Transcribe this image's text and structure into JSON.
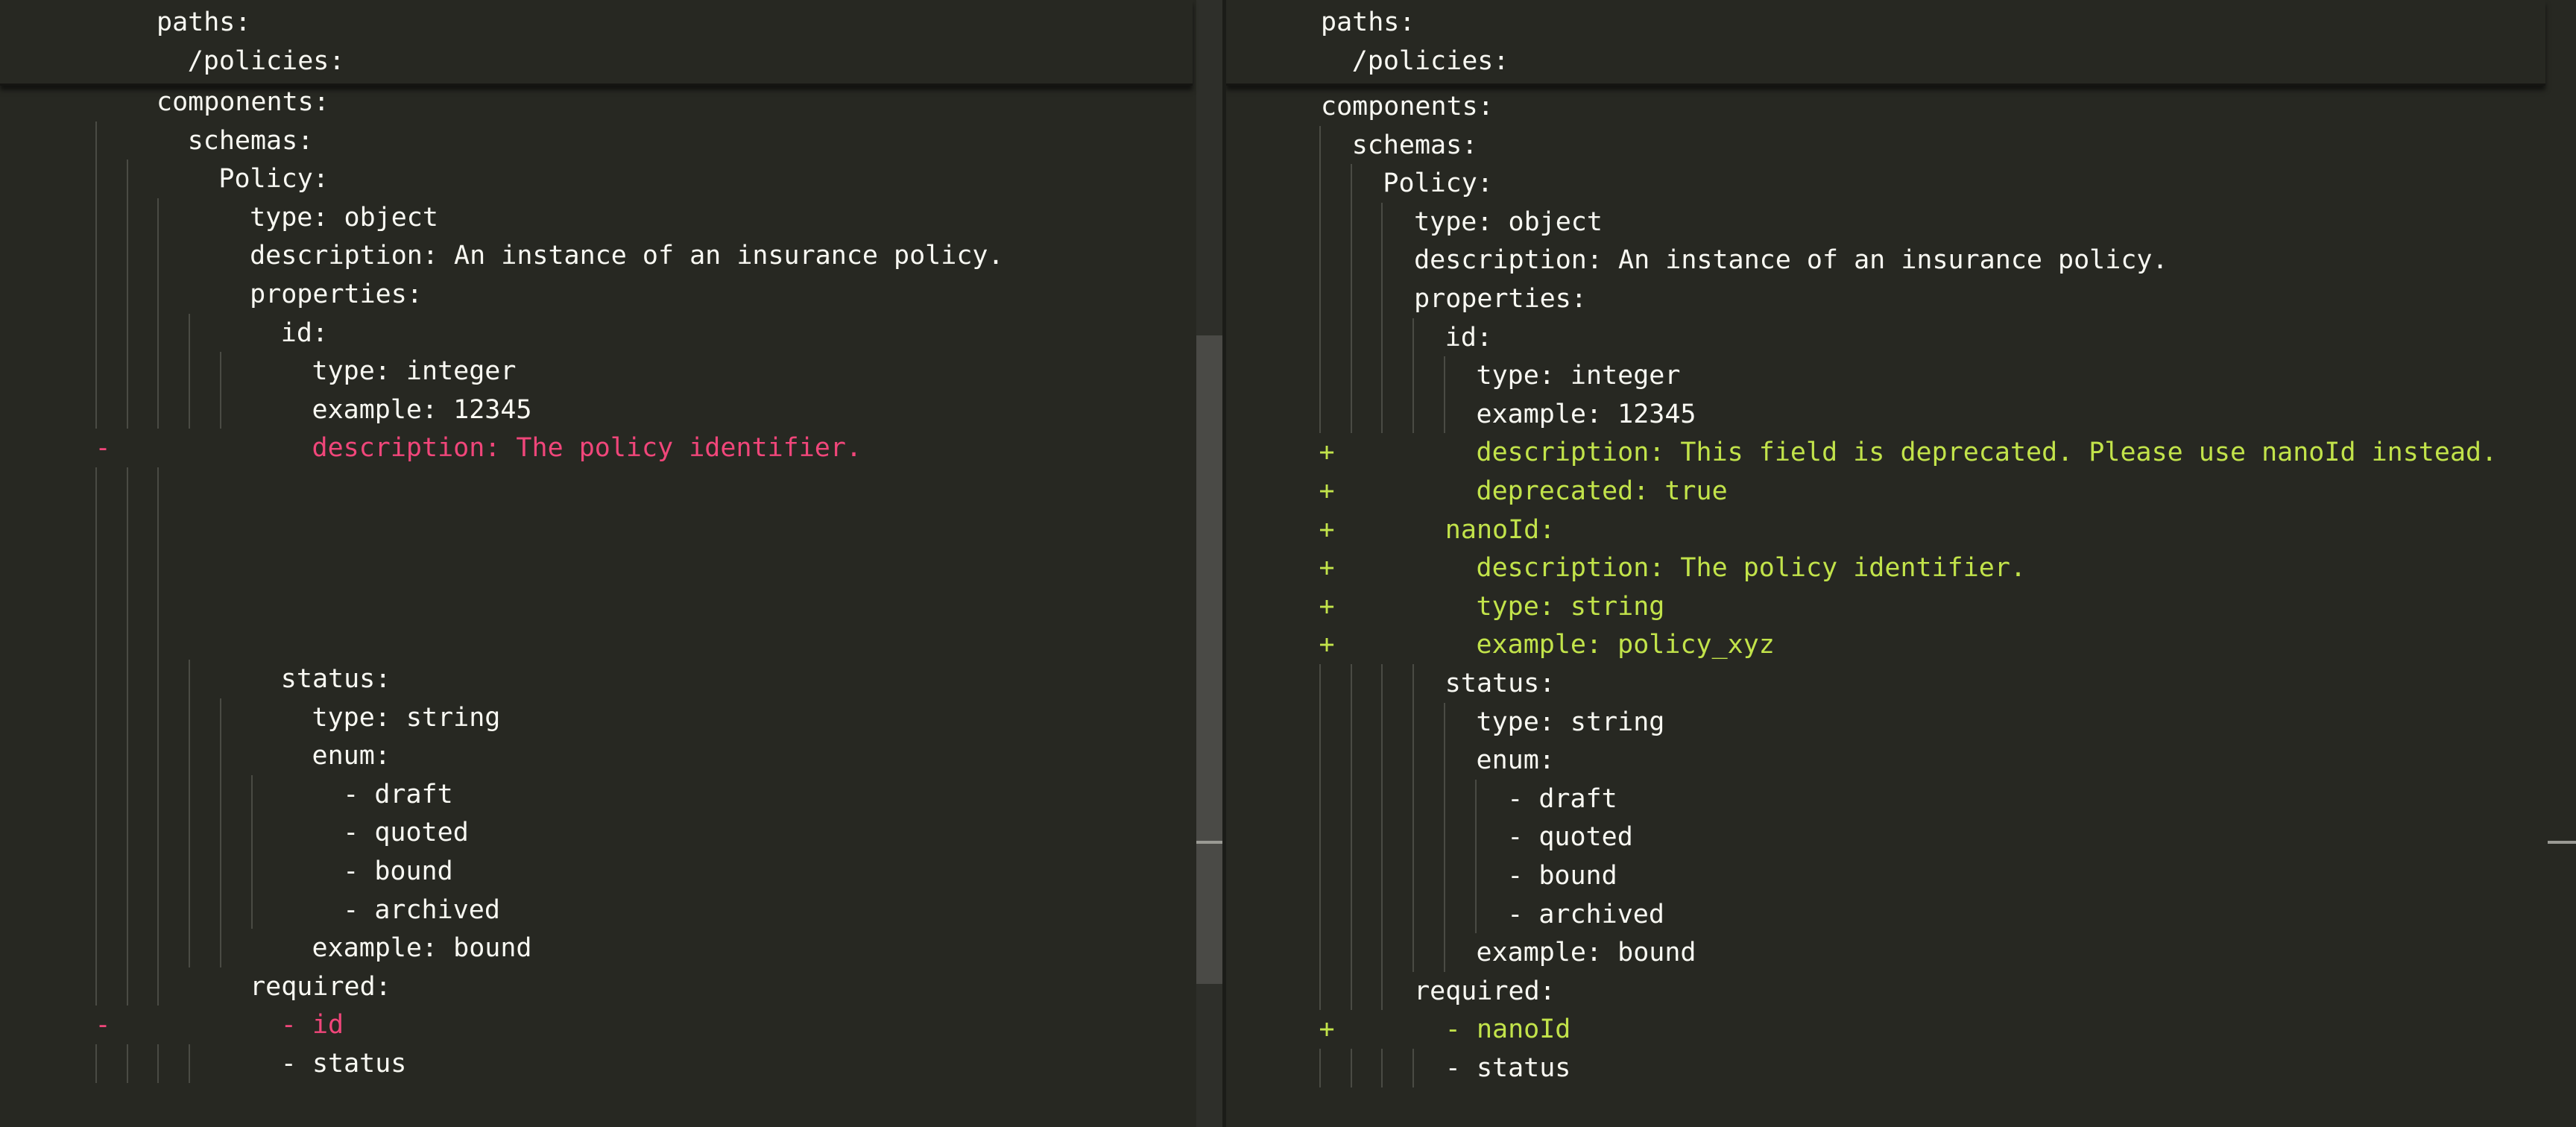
{
  "colors": {
    "background": "#272822",
    "text": "#f8f8f2",
    "removed": "#f0467a",
    "added": "#c2e34a",
    "indent_guide": "#4a4b44"
  },
  "left_pane": {
    "sticky_header": [
      {
        "indent": 0,
        "text": "paths:"
      },
      {
        "indent": 1,
        "text": "/policies:"
      }
    ],
    "lines": [
      {
        "indent": 0,
        "text": "components:",
        "type": "ctx"
      },
      {
        "indent": 1,
        "text": "schemas:",
        "type": "ctx"
      },
      {
        "indent": 2,
        "text": "Policy:",
        "type": "ctx"
      },
      {
        "indent": 3,
        "text": "type: object",
        "type": "ctx"
      },
      {
        "indent": 3,
        "text": "description: An instance of an insurance policy.",
        "type": "ctx"
      },
      {
        "indent": 3,
        "text": "properties:",
        "type": "ctx"
      },
      {
        "indent": 4,
        "text": "id:",
        "type": "ctx"
      },
      {
        "indent": 5,
        "text": "type: integer",
        "type": "ctx"
      },
      {
        "indent": 5,
        "text": "example: 12345",
        "type": "ctx"
      },
      {
        "indent": 5,
        "text": "description: The policy identifier.",
        "type": "del",
        "marker": "-"
      },
      {
        "indent": 0,
        "text": "",
        "type": "pad"
      },
      {
        "indent": 0,
        "text": "",
        "type": "pad"
      },
      {
        "indent": 0,
        "text": "",
        "type": "pad"
      },
      {
        "indent": 0,
        "text": "",
        "type": "pad"
      },
      {
        "indent": 0,
        "text": "",
        "type": "pad"
      },
      {
        "indent": 4,
        "text": "status:",
        "type": "ctx"
      },
      {
        "indent": 5,
        "text": "type: string",
        "type": "ctx"
      },
      {
        "indent": 5,
        "text": "enum:",
        "type": "ctx"
      },
      {
        "indent": 6,
        "text": "- draft",
        "type": "ctx"
      },
      {
        "indent": 6,
        "text": "- quoted",
        "type": "ctx"
      },
      {
        "indent": 6,
        "text": "- bound",
        "type": "ctx"
      },
      {
        "indent": 6,
        "text": "- archived",
        "type": "ctx"
      },
      {
        "indent": 5,
        "text": "example: bound",
        "type": "ctx"
      },
      {
        "indent": 3,
        "text": "required:",
        "type": "ctx"
      },
      {
        "indent": 4,
        "text": "- id",
        "type": "del",
        "marker": "-"
      },
      {
        "indent": 4,
        "text": "- status",
        "type": "ctx"
      }
    ]
  },
  "right_pane": {
    "sticky_header": [
      {
        "indent": 0,
        "text": "paths:"
      },
      {
        "indent": 1,
        "text": "/policies:"
      }
    ],
    "lines": [
      {
        "indent": 0,
        "text": "components:",
        "type": "ctx"
      },
      {
        "indent": 1,
        "text": "schemas:",
        "type": "ctx"
      },
      {
        "indent": 2,
        "text": "Policy:",
        "type": "ctx"
      },
      {
        "indent": 3,
        "text": "type: object",
        "type": "ctx"
      },
      {
        "indent": 3,
        "text": "description: An instance of an insurance policy.",
        "type": "ctx"
      },
      {
        "indent": 3,
        "text": "properties:",
        "type": "ctx"
      },
      {
        "indent": 4,
        "text": "id:",
        "type": "ctx"
      },
      {
        "indent": 5,
        "text": "type: integer",
        "type": "ctx"
      },
      {
        "indent": 5,
        "text": "example: 12345",
        "type": "ctx"
      },
      {
        "indent": 5,
        "text": "description: This field is deprecated. Please use nanoId instead.",
        "type": "add",
        "marker": "+"
      },
      {
        "indent": 5,
        "text": "deprecated: true",
        "type": "add",
        "marker": "+"
      },
      {
        "indent": 4,
        "text": "nanoId:",
        "type": "add",
        "marker": "+"
      },
      {
        "indent": 5,
        "text": "description: The policy identifier.",
        "type": "add",
        "marker": "+"
      },
      {
        "indent": 5,
        "text": "type: string",
        "type": "add",
        "marker": "+"
      },
      {
        "indent": 5,
        "text": "example: policy_xyz",
        "type": "add",
        "marker": "+"
      },
      {
        "indent": 4,
        "text": "status:",
        "type": "ctx"
      },
      {
        "indent": 5,
        "text": "type: string",
        "type": "ctx"
      },
      {
        "indent": 5,
        "text": "enum:",
        "type": "ctx"
      },
      {
        "indent": 6,
        "text": "- draft",
        "type": "ctx"
      },
      {
        "indent": 6,
        "text": "- quoted",
        "type": "ctx"
      },
      {
        "indent": 6,
        "text": "- bound",
        "type": "ctx"
      },
      {
        "indent": 6,
        "text": "- archived",
        "type": "ctx"
      },
      {
        "indent": 5,
        "text": "example: bound",
        "type": "ctx"
      },
      {
        "indent": 3,
        "text": "required:",
        "type": "ctx"
      },
      {
        "indent": 4,
        "text": "- nanoId",
        "type": "add",
        "marker": "+"
      },
      {
        "indent": 4,
        "text": "- status",
        "type": "ctx"
      }
    ]
  }
}
